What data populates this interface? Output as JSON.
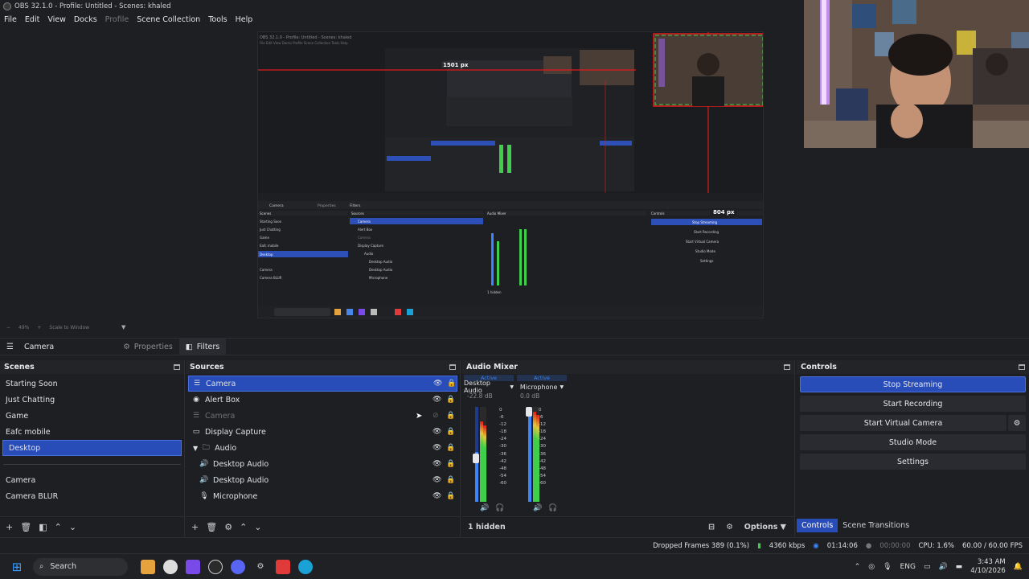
{
  "window": {
    "title": "OBS 32.1.0 - Profile: Untitled - Scenes: khaled"
  },
  "menu": [
    "File",
    "Edit",
    "View",
    "Docks",
    "Profile",
    "Scene Collection",
    "Tools",
    "Help"
  ],
  "preview": {
    "nested_measure_1": "1501 px",
    "nested_measure_2": "804 px",
    "zoom_label": "49%",
    "scale_mode": "Scale to Window"
  },
  "source_toolbar": {
    "selected_source": "Camera",
    "properties": "Properties",
    "filters": "Filters"
  },
  "scenes": {
    "title": "Scenes",
    "items": [
      "Starting Soon",
      "Just Chatting",
      "Game",
      "Eafc mobile",
      "Desktop"
    ],
    "selected": "Desktop",
    "extra_items": [
      "Camera",
      "Camera BLUR"
    ]
  },
  "sources": {
    "title": "Sources",
    "items": [
      {
        "name": "Camera",
        "icon": "list-icon",
        "indent": 0
      },
      {
        "name": "Alert Box",
        "icon": "browser-icon",
        "indent": 0
      },
      {
        "name": "Camera",
        "icon": "list-icon",
        "indent": 0
      },
      {
        "name": "Display Capture",
        "icon": "monitor-icon",
        "indent": 0
      },
      {
        "name": "Audio",
        "icon": "folder-icon",
        "indent": 1
      },
      {
        "name": "Desktop Audio",
        "icon": "speaker-icon",
        "indent": 2
      },
      {
        "name": "Desktop Audio",
        "icon": "speaker-icon",
        "indent": 2
      },
      {
        "name": "Microphone",
        "icon": "mic-icon",
        "indent": 2
      }
    ]
  },
  "mixer": {
    "title": "Audio Mixer",
    "hidden_count": "1 hidden",
    "channels": [
      {
        "active": "Active",
        "name": "Desktop Audio",
        "db": "-22.8 dB",
        "level": 0.55
      },
      {
        "active": "Active",
        "name": "Microphone",
        "db": "0.0 dB",
        "level": 0.95
      }
    ],
    "scale": [
      "0",
      "-6",
      "-12",
      "-18",
      "-24",
      "-30",
      "-36",
      "-42",
      "-48",
      "-54",
      "-60"
    ]
  },
  "controls": {
    "title": "Controls",
    "buttons": [
      "Stop Streaming",
      "Start Recording",
      "Start Virtual Camera",
      "Studio Mode",
      "Settings"
    ],
    "options": "Options",
    "tabs": [
      "Controls",
      "Scene Transitions"
    ]
  },
  "status": {
    "dropped": "Dropped Frames 389 (0.1%)",
    "bitrate": "4360 kbps",
    "stream_time": "01:14:06",
    "rec_time": "00:00:00",
    "cpu": "CPU: 1.6%",
    "fps": "60.00 / 60.00 FPS"
  },
  "taskbar": {
    "search": "Search",
    "lang": "ENG",
    "time": "3:43 AM",
    "date": "4/10/2026"
  },
  "colors": {
    "accent": "#284cb8",
    "red": "#e01b1b",
    "green": "#3fcf4a"
  }
}
